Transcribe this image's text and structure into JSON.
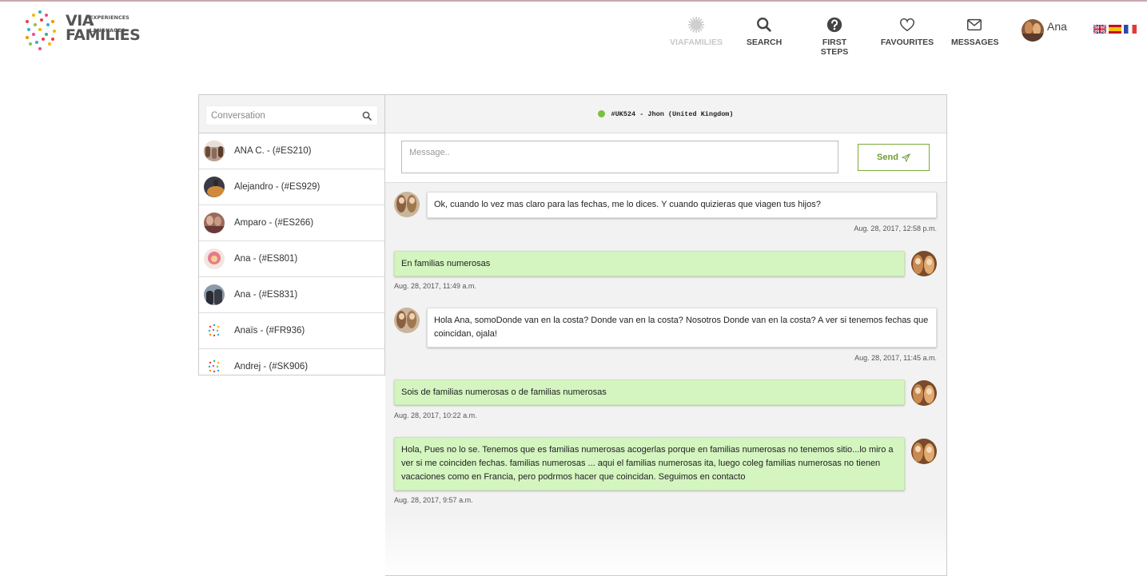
{
  "header": {
    "logo": {
      "line1": "VIA",
      "tagline": "EXPERIENCES & LANGUAGES",
      "line2": "FAMILIES"
    },
    "nav": [
      {
        "label": "VIAFAMILIES",
        "icon": "gear-icon"
      },
      {
        "label": "SEARCH",
        "icon": "search-icon"
      },
      {
        "label": "FIRST STEPS",
        "icon": "question-icon"
      },
      {
        "label": "FAVOURITES",
        "icon": "heart-icon"
      },
      {
        "label": "MESSAGES",
        "icon": "envelope-icon"
      }
    ],
    "user": {
      "name": "Ana"
    },
    "languages": [
      "flag-uk-icon",
      "flag-es-icon",
      "flag-fr-icon"
    ]
  },
  "sidebar": {
    "search_placeholder": "Conversation",
    "conversations": [
      {
        "label": "ANA C. - (#ES210)"
      },
      {
        "label": "Alejandro - (#ES929)"
      },
      {
        "label": "Amparo - (#ES266)"
      },
      {
        "label": "Ana - (#ES801)"
      },
      {
        "label": "Ana - (#ES831)"
      },
      {
        "label": "Anaïs - (#FR936)"
      },
      {
        "label": "Andrej - (#SK906)"
      }
    ]
  },
  "chat": {
    "title": "#UK524 - Jhon (United Kingdom)",
    "status_color": "#7ac142",
    "message_placeholder": "Message..",
    "send_label": "Send",
    "messages": [
      {
        "direction": "in",
        "text": "Ok, cuando lo vez mas claro para las fechas, me lo dices. Y cuando quizieras que viagen tus hijos?",
        "time": "Aug. 28, 2017, 12:58 p.m."
      },
      {
        "direction": "out",
        "text": "En  familias numerosas",
        "time": "Aug. 28, 2017, 11:49 a.m."
      },
      {
        "direction": "in",
        "text": "Hola Ana, somoDonde van en la costa? Donde van en la costa? Nosotros Donde van en la costa? A ver si tenemos fechas que coincidan, ojala!",
        "time": "Aug. 28, 2017, 11:45 a.m."
      },
      {
        "direction": "out",
        "text": "Sois de familias numerosas o de  familias numerosas",
        "time": "Aug. 28, 2017, 10:22 a.m."
      },
      {
        "direction": "out",
        "text": "Hola, Pues no lo se. Tenemos que es familias numerosas acogerlas porque en  familias numerosas  no tenemos sitio...lo miro a ver si me coinciden fechas.   familias numerosas ... aqui el  familias numerosas ita, luego coleg familias numerosas  no tienen vacaciones como en Francia, pero podrmos hacer que coincidan. Seguimos en contacto",
        "time": "Aug. 28, 2017, 9:57 a.m."
      }
    ]
  }
}
